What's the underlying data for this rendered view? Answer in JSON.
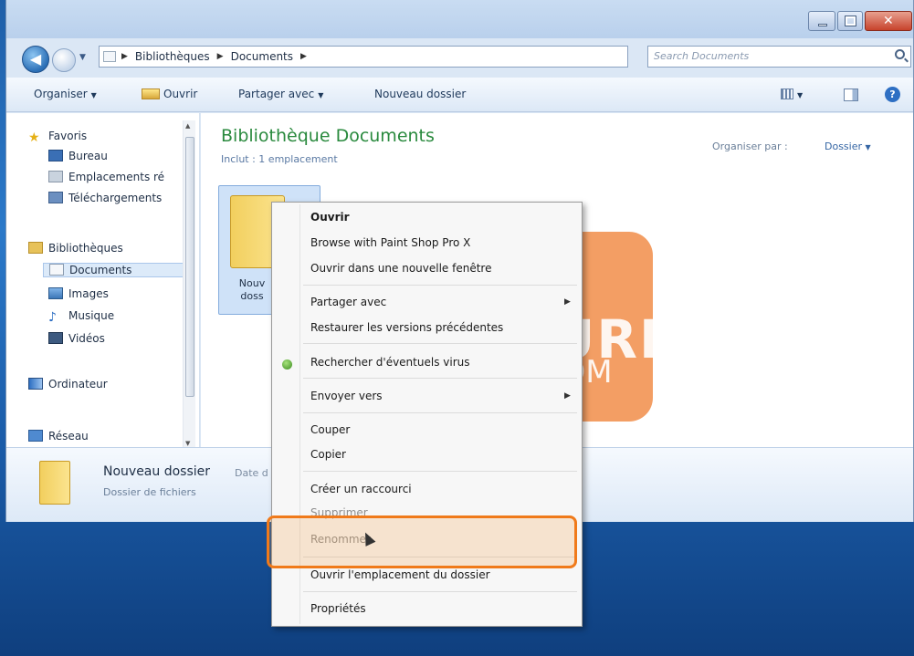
{
  "window": {
    "address": {
      "crumbs": [
        "Bibliothèques",
        "Documents"
      ]
    },
    "search": {
      "placeholder": "Search Documents"
    },
    "toolbar": {
      "organise": "Organiser",
      "open": "Ouvrir",
      "share": "Partager avec",
      "new_folder": "Nouveau dossier"
    },
    "nav": {
      "favorites": "Favoris",
      "desktop": "Bureau",
      "recent_places": "Emplacements ré",
      "downloads": "Téléchargements",
      "libraries": "Bibliothèques",
      "documents": "Documents",
      "images": "Images",
      "music": "Musique",
      "videos": "Vidéos",
      "computer": "Ordinateur",
      "network": "Réseau"
    },
    "content": {
      "title": "Bibliothèque Documents",
      "subtitle": "Inclut : 1 emplacement",
      "sort_label": "Organiser par :",
      "sort_value": "Dossier",
      "item_label_line1": "Nouv",
      "item_label_line2": "doss"
    },
    "details": {
      "name": "Nouveau dossier",
      "date": "Date d",
      "type": "Dossier de fichiers"
    }
  },
  "context_menu": {
    "items": [
      "Ouvrir",
      "Browse with Paint Shop Pro X",
      "Ouvrir dans une nouvelle fenêtre",
      "Partager avec",
      "Restaurer les versions précédentes",
      "Rechercher d'éventuels virus",
      "Envoyer vers",
      "Couper",
      "Copier",
      "Créer un raccourci",
      "Supprimer",
      "Renommer",
      "Ouvrir l'emplacement du dossier",
      "Propriétés"
    ]
  },
  "watermark": {
    "line1": "KACHOURI",
    "line2": ".COM"
  },
  "colors": {
    "highlight": "#f07a1a",
    "library_title": "#2a8a3e",
    "watermark": "#ee7828"
  }
}
